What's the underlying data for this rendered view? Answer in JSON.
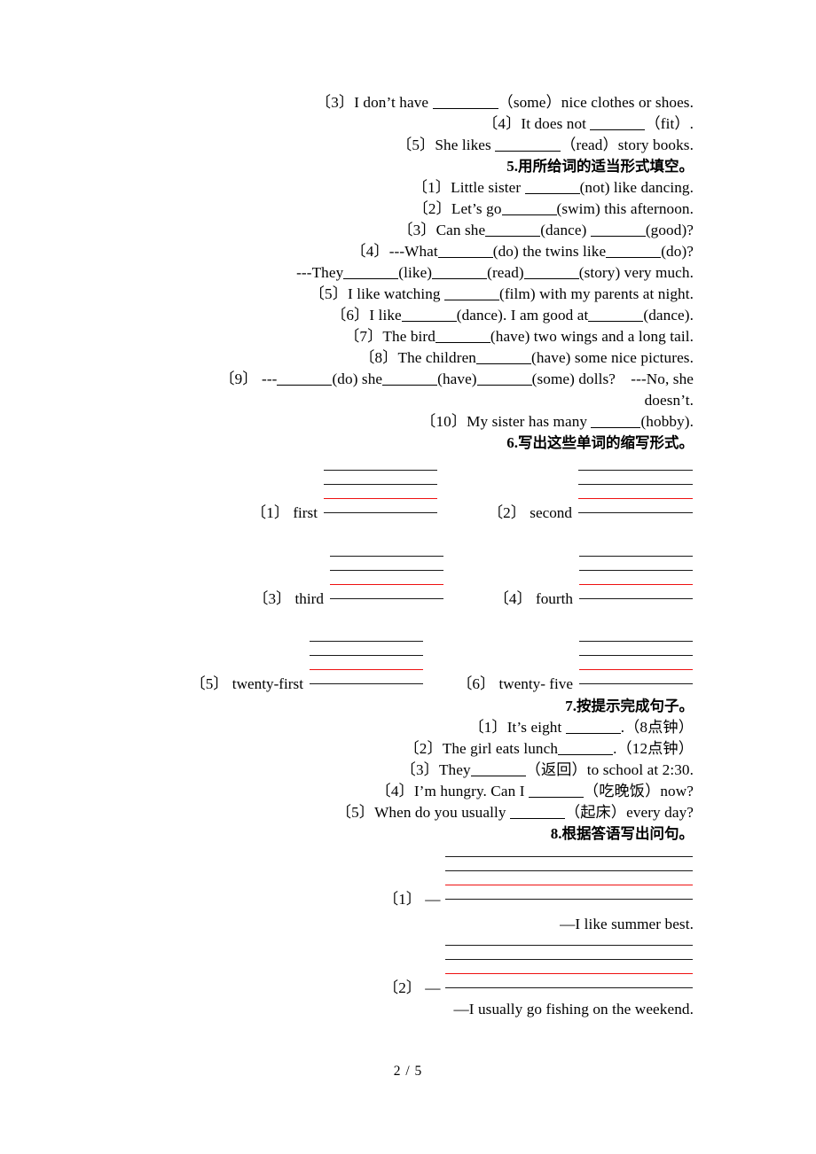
{
  "document": {
    "footer": "2 / 5"
  },
  "lines_top": [
    {
      "id": "q4-3",
      "num": "〔3〕",
      "pre": "I don’t have ",
      "blank": "b-lg",
      "post": "（some）nice clothes or shoes."
    },
    {
      "id": "q4-4",
      "num": "〔4〕",
      "pre": "It does not ",
      "blank": "b-md",
      "post": "（fit）."
    },
    {
      "id": "q4-5",
      "num": "〔5〕",
      "pre": "She likes ",
      "blank": "b-lg",
      "post": "（read）story books."
    }
  ],
  "section5": {
    "heading_num": "5.",
    "heading_text": "用所给词的适当形式填空。",
    "items": [
      {
        "num": "〔1〕",
        "parts": [
          "Little sister ",
          "__",
          "(not) like dancing."
        ]
      },
      {
        "num": "〔2〕",
        "parts": [
          "Let’s go",
          "__",
          "(swim) this afternoon."
        ]
      },
      {
        "num": "〔3〕",
        "parts": [
          "Can she",
          "__",
          "(dance) ",
          "__",
          "(good)?"
        ]
      },
      {
        "num": "〔4〕",
        "parts": [
          "---What",
          "__",
          "(do) the twins like",
          "__",
          "(do)?"
        ]
      },
      {
        "num": "",
        "parts": [
          "---They",
          "__",
          "(like)",
          "__",
          "(read)",
          "__",
          "(story) very much."
        ]
      },
      {
        "num": "〔5〕",
        "parts": [
          "I like watching ",
          "__",
          "(film) with my parents at night."
        ]
      },
      {
        "num": "〔6〕",
        "parts": [
          "I like",
          "__",
          "(dance). I am good at",
          "__",
          "(dance)."
        ]
      },
      {
        "num": "〔7〕",
        "parts": [
          "The bird",
          "__",
          "(have) two wings and a long tail."
        ]
      },
      {
        "num": "〔8〕",
        "parts": [
          "The children",
          "__",
          "(have) some nice pictures."
        ]
      },
      {
        "num": "〔9〕",
        "parts": [
          "---",
          "__",
          "(do) she",
          "__",
          "(have)",
          "__",
          "(some) dolls? ---No, she"
        ]
      },
      {
        "num": "",
        "parts": [
          "doesn’t."
        ]
      },
      {
        "num": "〔10〕",
        "parts": [
          "My sister has many ",
          "__",
          "(hobby)."
        ]
      }
    ]
  },
  "section6": {
    "heading_num": "6.",
    "heading_text": "写出这些单词的缩写形式。",
    "items": [
      {
        "num": "〔1〕",
        "word": "first"
      },
      {
        "num": "〔2〕",
        "word": "second"
      },
      {
        "num": "〔3〕",
        "word": "third"
      },
      {
        "num": "〔4〕",
        "word": "fourth"
      },
      {
        "num": "〔5〕",
        "word": "twenty-first"
      },
      {
        "num": "〔6〕",
        "word": "twenty- five"
      }
    ]
  },
  "section7": {
    "heading_num": "7.",
    "heading_text": "按提示完成句子。",
    "items": [
      {
        "num": "〔1〕",
        "pre": "It’s eight ",
        "post": ".（8点钟）"
      },
      {
        "num": "〔2〕",
        "pre": "The girl eats lunch",
        "post": ".（12点钟）"
      },
      {
        "num": "〔3〕",
        "pre": "They",
        "post": "（返回）to school at 2:30."
      },
      {
        "num": "〔4〕",
        "pre": "I’m hungry. Can I ",
        "post": "（吃晚饭）now?"
      },
      {
        "num": "〔5〕",
        "pre": "When do you usually ",
        "post": "（起床）every day?"
      }
    ]
  },
  "section8": {
    "heading_num": "8.",
    "heading_text": "根据答语写出问句。",
    "items": [
      {
        "num": "〔1〕",
        "dash": "—",
        "answer": "—I like summer best."
      },
      {
        "num": "〔2〕",
        "dash": "—",
        "answer": "—I usually go fishing on the weekend."
      }
    ]
  },
  "colors": {
    "guide_black": "#1a1a1a",
    "guide_red": "#ee1111",
    "text": "#000000"
  }
}
